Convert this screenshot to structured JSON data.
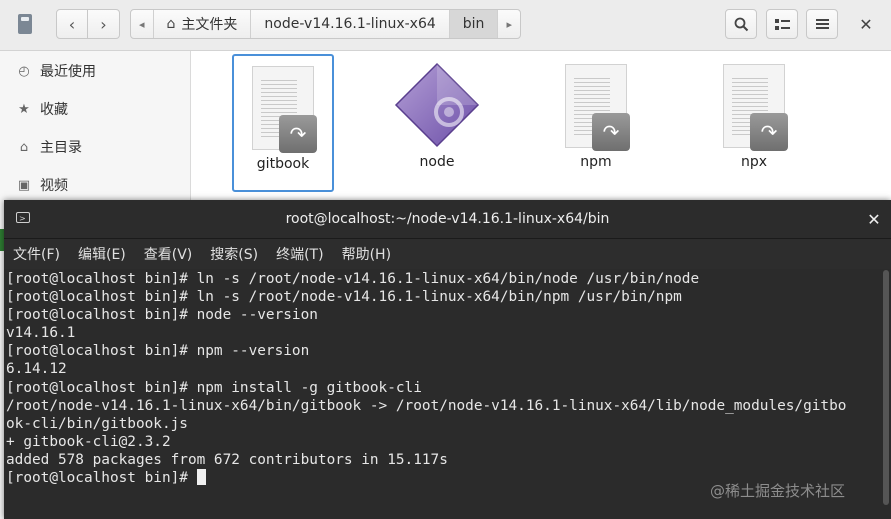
{
  "file_manager": {
    "breadcrumbs": [
      "主文件夹",
      "node-v14.16.1-linux-x64",
      "bin"
    ],
    "sidebar": [
      {
        "label": "最近使用",
        "icon": "clock-icon"
      },
      {
        "label": "收藏",
        "icon": "star-icon"
      },
      {
        "label": "主目录",
        "icon": "home-icon"
      },
      {
        "label": "视频",
        "icon": "video-icon"
      }
    ],
    "files": [
      {
        "name": "gitbook",
        "icon": "script-link-icon",
        "selected": true
      },
      {
        "name": "node",
        "icon": "executable-diamond-icon",
        "selected": false
      },
      {
        "name": "npm",
        "icon": "script-link-icon",
        "selected": false
      },
      {
        "name": "npx",
        "icon": "script-link-icon",
        "selected": false
      }
    ]
  },
  "terminal": {
    "title": "root@localhost:~/node-v14.16.1-linux-x64/bin",
    "menu": [
      "文件(F)",
      "编辑(E)",
      "查看(V)",
      "搜索(S)",
      "终端(T)",
      "帮助(H)"
    ],
    "lines": [
      "[root@localhost bin]# ln -s /root/node-v14.16.1-linux-x64/bin/node /usr/bin/node",
      "[root@localhost bin]# ln -s /root/node-v14.16.1-linux-x64/bin/npm /usr/bin/npm",
      "[root@localhost bin]# node --version",
      "v14.16.1",
      "[root@localhost bin]# npm --version",
      "6.14.12",
      "[root@localhost bin]# npm install -g gitbook-cli",
      "/root/node-v14.16.1-linux-x64/bin/gitbook -> /root/node-v14.16.1-linux-x64/lib/node_modules/gitbo",
      "ok-cli/bin/gitbook.js",
      "+ gitbook-cli@2.3.2",
      "added 578 packages from 672 contributors in 15.117s",
      "[root@localhost bin]# "
    ]
  },
  "watermark": "@稀土掘金技术社区"
}
